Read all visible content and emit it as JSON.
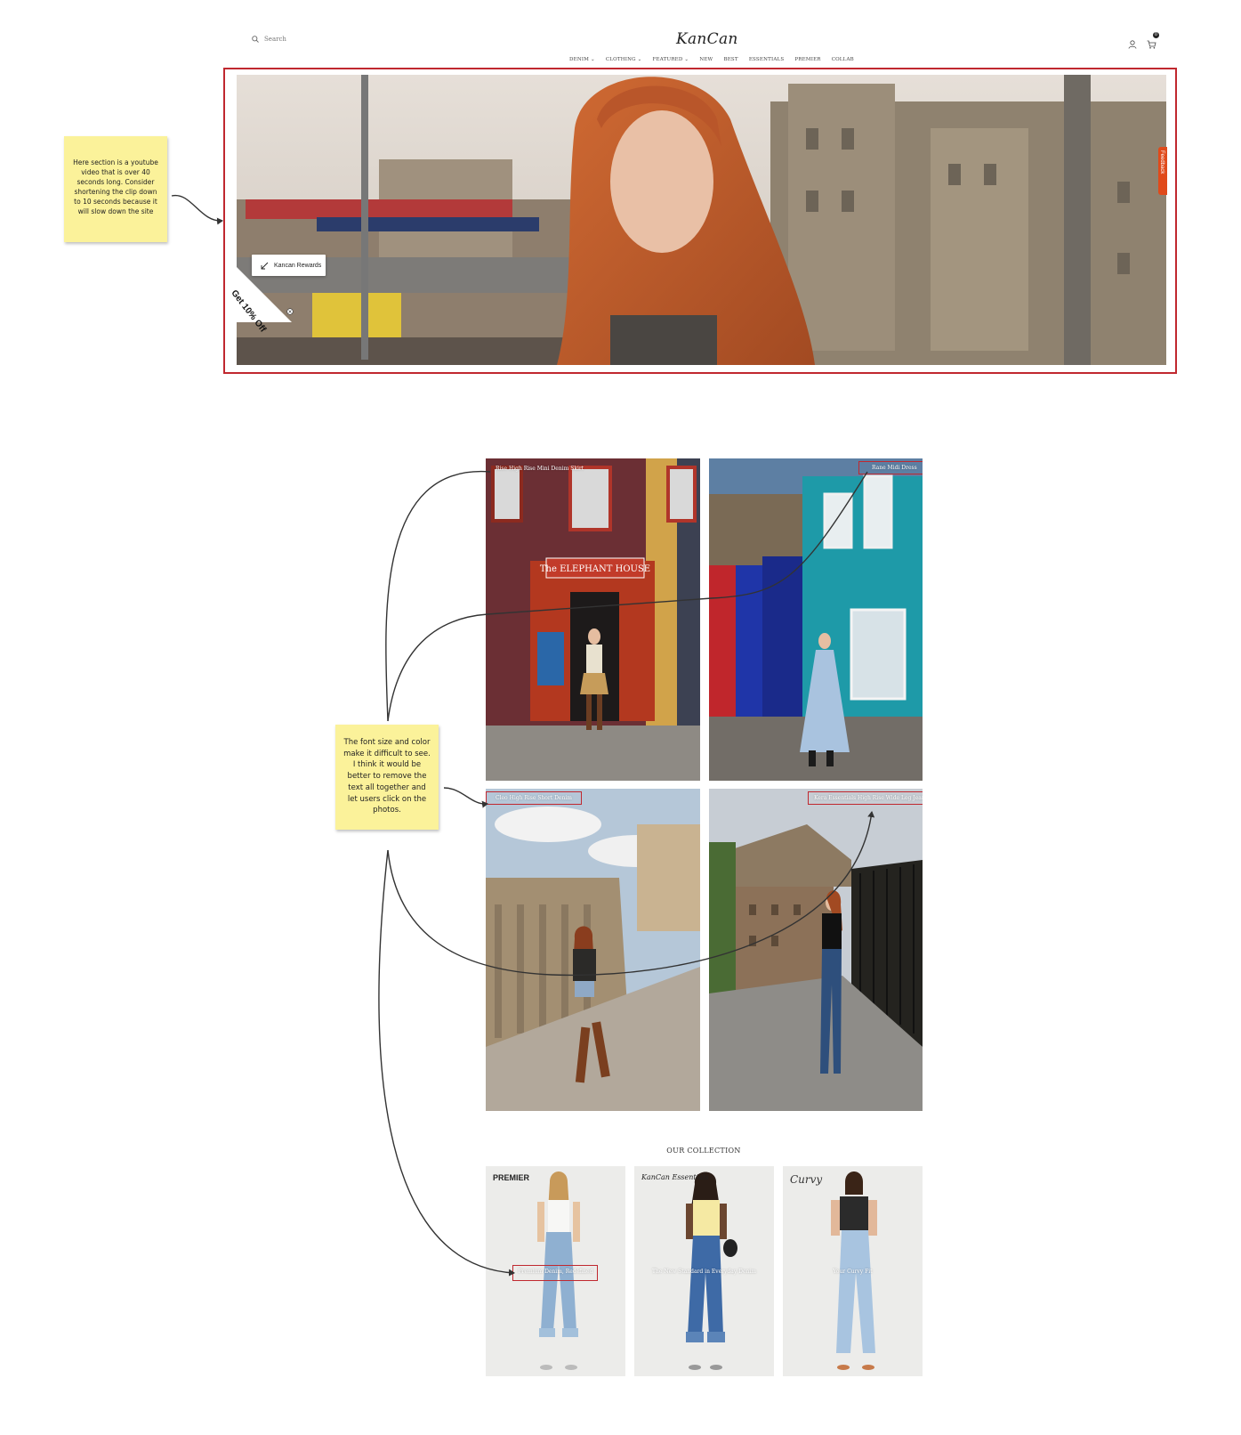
{
  "header": {
    "search_placeholder": "Search",
    "logo": "KanCan",
    "nav": [
      "DENIM ⌄",
      "CLOTHING ⌄",
      "FEATURED ⌄",
      "NEW",
      "BEST",
      "ESSENTIALS",
      "PREMIER",
      "COLLAB"
    ],
    "cart_count": "0"
  },
  "hero": {
    "rewards_label": "Kancan Rewards",
    "promo_label": "Get 10% Off",
    "feedback_label": "Feedback"
  },
  "notes": {
    "note1": "Here section is a youtube video that is over 40 seconds long. Consider shortening the clip down to 10 seconds because it will slow down the site",
    "note2": "The font size and color make it difficult to see. I think it would be better to remove the text all together and let users click on the photos."
  },
  "grid": {
    "captions": [
      "Rise High Rise Mini Denim Skirt",
      "Rane Midi Dress",
      "Cleo High Rise Short Denim",
      "Kera Essentials High Rise Wide Leg Jeans"
    ]
  },
  "collection": {
    "title": "OUR COLLECTION",
    "cards": [
      {
        "brand": "PREMIER",
        "tagline": "Premium Denim, Redefined"
      },
      {
        "brand": "KanCan Essentials",
        "tagline": "The New Standard in Everyday Denim"
      },
      {
        "brand": "Curvy",
        "tagline": "Your Curvy Fit"
      }
    ]
  },
  "colors": {
    "annotation_red": "#c0282f",
    "sticky_yellow": "#fbf29a",
    "feedback_orange": "#e04a1a"
  }
}
